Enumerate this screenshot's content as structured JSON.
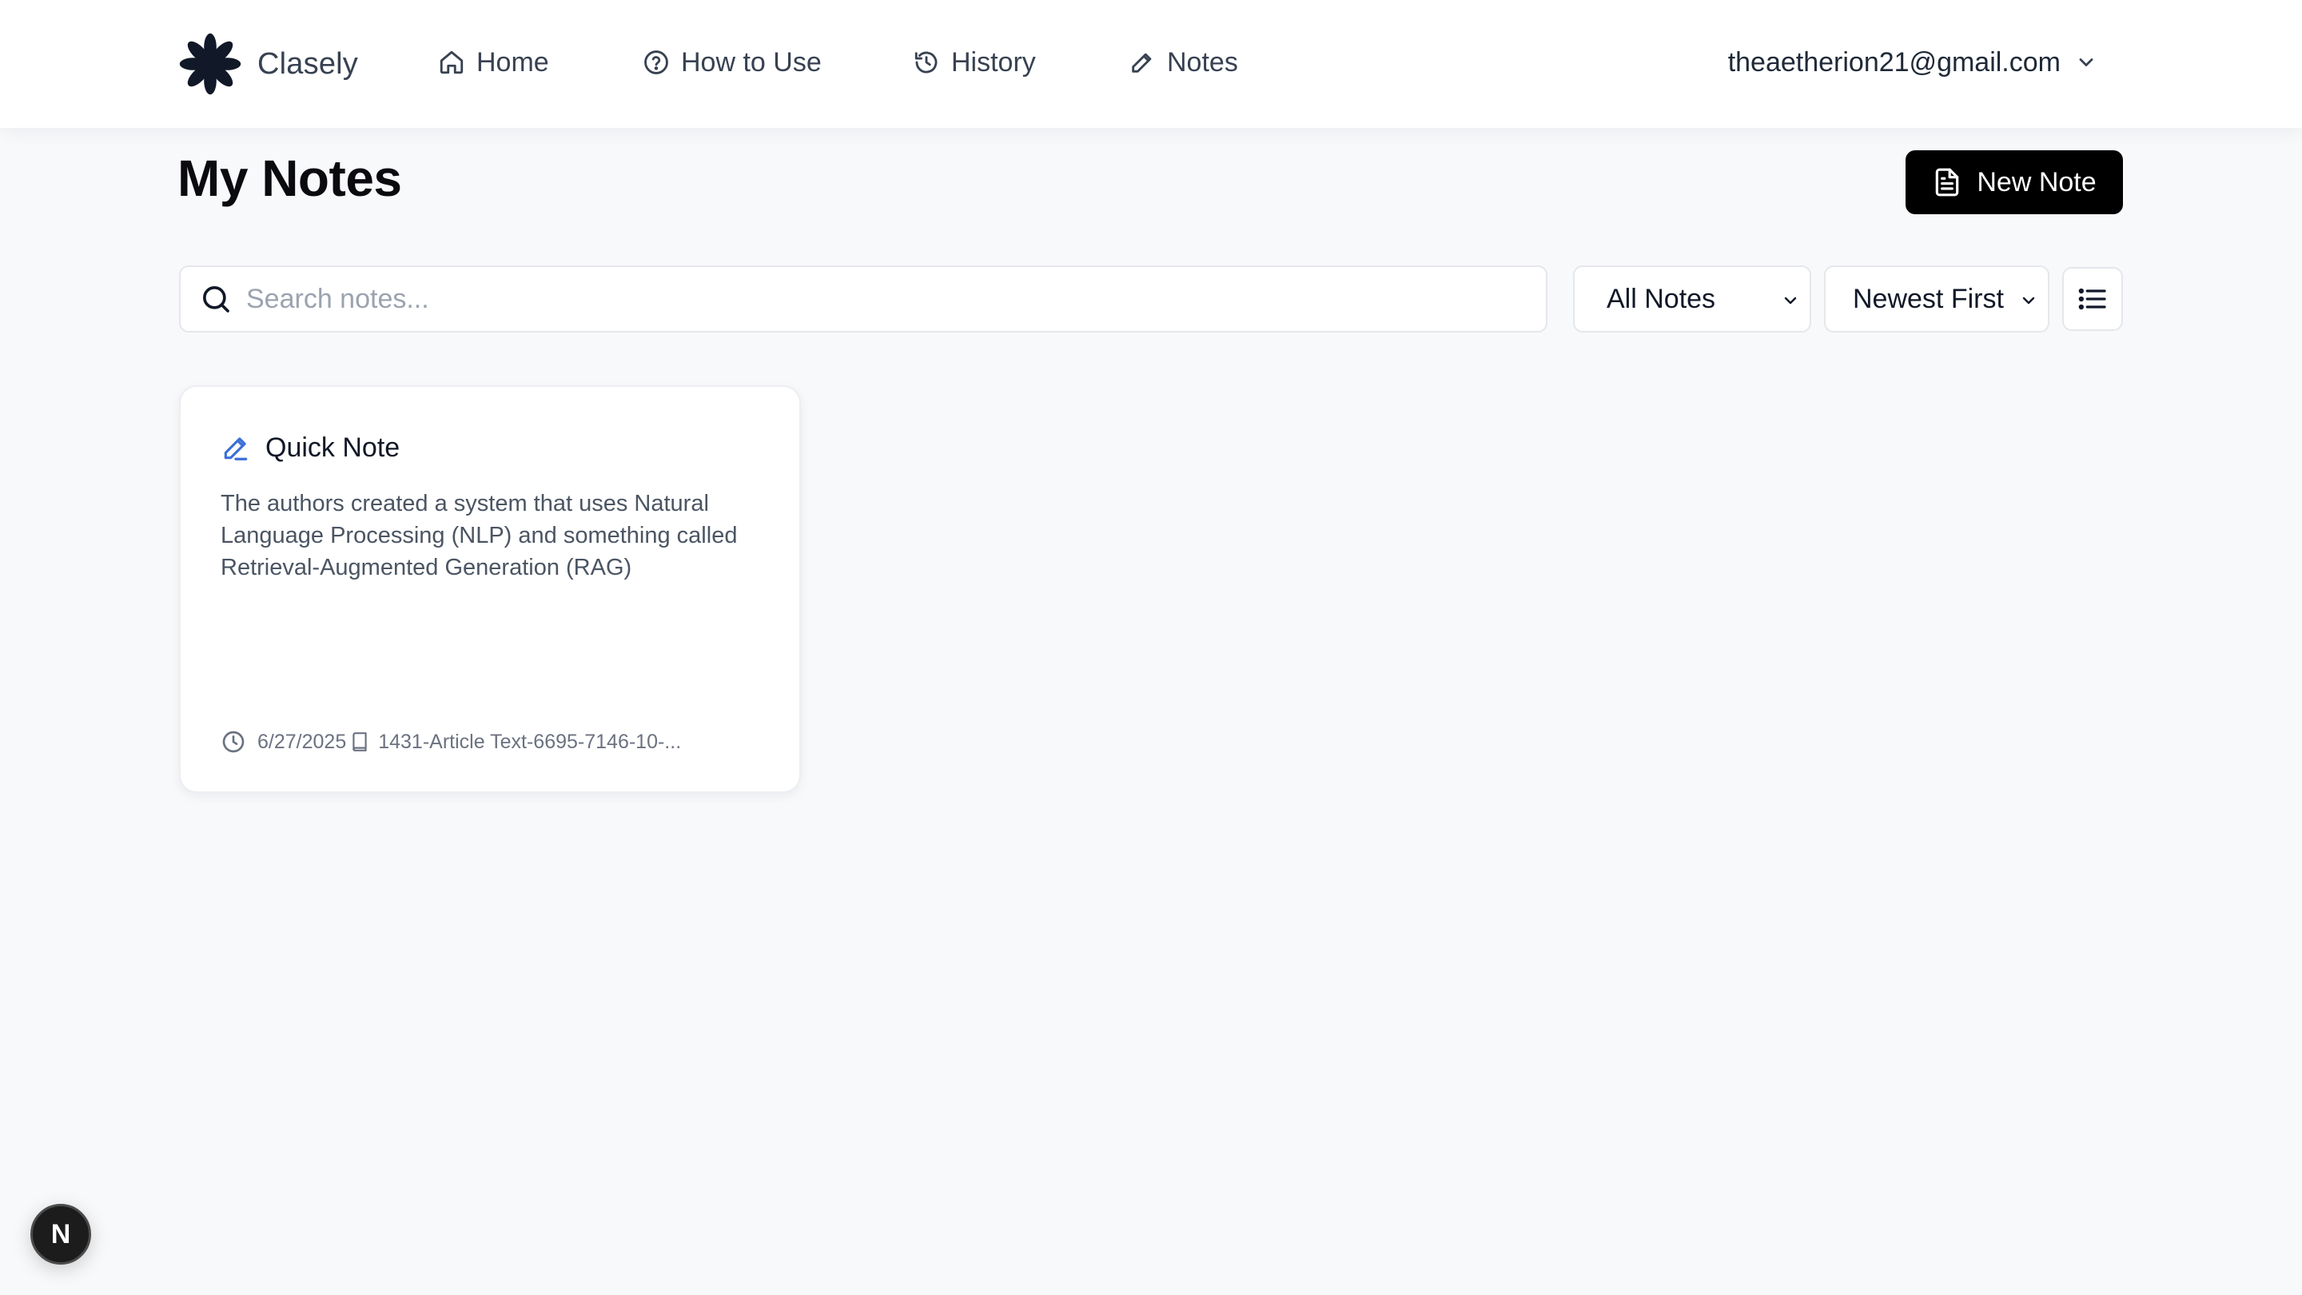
{
  "brand": {
    "name": "Clasely",
    "logo_icon": "asterisk-flower-logo"
  },
  "nav": [
    {
      "label": "Home",
      "icon": "home-icon"
    },
    {
      "label": "How to Use",
      "icon": "help-circle-icon"
    },
    {
      "label": "History",
      "icon": "history-icon"
    },
    {
      "label": "Notes",
      "icon": "pencil-icon"
    }
  ],
  "account": {
    "email": "theaetherion21@gmail.com",
    "icon": "chevron-down-icon"
  },
  "page": {
    "title": "My Notes",
    "new_note_label": "New Note"
  },
  "search": {
    "placeholder": "Search notes...",
    "value": ""
  },
  "filters": {
    "category": {
      "selected": "All Notes"
    },
    "sort": {
      "selected": "Newest First"
    },
    "view_toggle_icon": "list-icon"
  },
  "notes": [
    {
      "title": "Quick Note",
      "body": "The authors created a system that uses Natural Language Processing (NLP) and something called Retrieval-Augmented Generation (RAG)",
      "date": "6/27/2025",
      "source": "1431-Article Text-6695-7146-10-..."
    }
  ],
  "dev_badge": {
    "label": "N"
  },
  "colors": {
    "background": "#f8f9fb",
    "primary_button": "#000000",
    "note_icon_accent": "#3b6fd8",
    "text_muted": "#6b7280"
  }
}
